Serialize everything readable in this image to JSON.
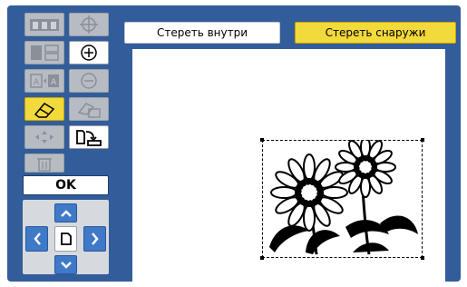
{
  "top_buttons": {
    "erase_inside": "Стереть внутри",
    "erase_outside": "Стереть снаружи"
  },
  "ok_label": "OK",
  "tools": [
    {
      "name": "tool-grid-pages",
      "state": "disabled"
    },
    {
      "name": "tool-zoom-in",
      "state": "enabled"
    },
    {
      "name": "tool-page-layout",
      "state": "disabled"
    },
    {
      "name": "tool-zoom-out",
      "state": "disabled"
    },
    {
      "name": "tool-a-to-a",
      "state": "disabled"
    },
    {
      "name": "tool-erase-area",
      "state": "disabled"
    },
    {
      "name": "tool-eraser",
      "state": "active"
    },
    {
      "name": "tool-rotate",
      "state": "enabled"
    },
    {
      "name": "tool-move",
      "state": "disabled"
    },
    {
      "name": "tool-delete",
      "state": "disabled"
    }
  ],
  "colors": {
    "panel": "#325d9a",
    "accent": "#f2d93c",
    "dpad": "#3f79c8"
  }
}
